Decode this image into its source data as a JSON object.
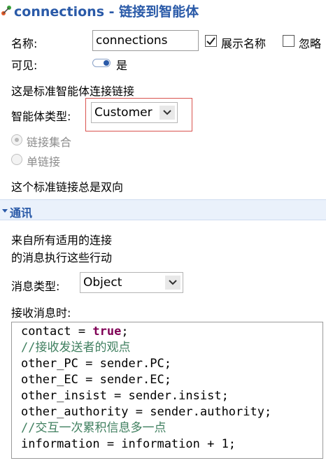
{
  "title": {
    "name": "connections",
    "separator": " - ",
    "subtitle": "链接到智能体"
  },
  "form": {
    "name_label": "名称:",
    "name_value": "connections",
    "show_name_label": "展示名称",
    "show_name_checked": true,
    "ignore_label": "忽略",
    "visible_label": "可见:",
    "visible_value": "是",
    "standard_info": "这是标准智能体连接链接",
    "agent_type_label": "智能体类型:",
    "agent_type_value": "Customer",
    "radio_collection": "链接集合",
    "radio_single": "单链接",
    "bidirectional_info": "这个标准链接总是双向"
  },
  "comm_section": {
    "title": "通讯",
    "desc_line1": "来自所有适用的连接",
    "desc_line2": "的消息执行这些行动",
    "message_type_label": "消息类型:",
    "message_type_value": "Object",
    "on_receive_label": "接收消息时:"
  },
  "code": {
    "line1_a": "contact = ",
    "line1_kw": "true",
    "line1_b": ";",
    "line2": "//接收发送者的观点",
    "line3": "other_PC = sender.PC;",
    "line4": "other_EC = sender.EC;",
    "line5": "other_insist = sender.insist;",
    "line6": "other_authority = sender.authority;",
    "line7": "//交互一次累积信息多一点",
    "line8": "information = information + 1;"
  },
  "colors": {
    "title": "#2a5aa8",
    "highlight_box": "#d9534f",
    "section_bg": "#eaf1fb",
    "keyword": "#7f0055",
    "comment": "#3f7f5f"
  }
}
